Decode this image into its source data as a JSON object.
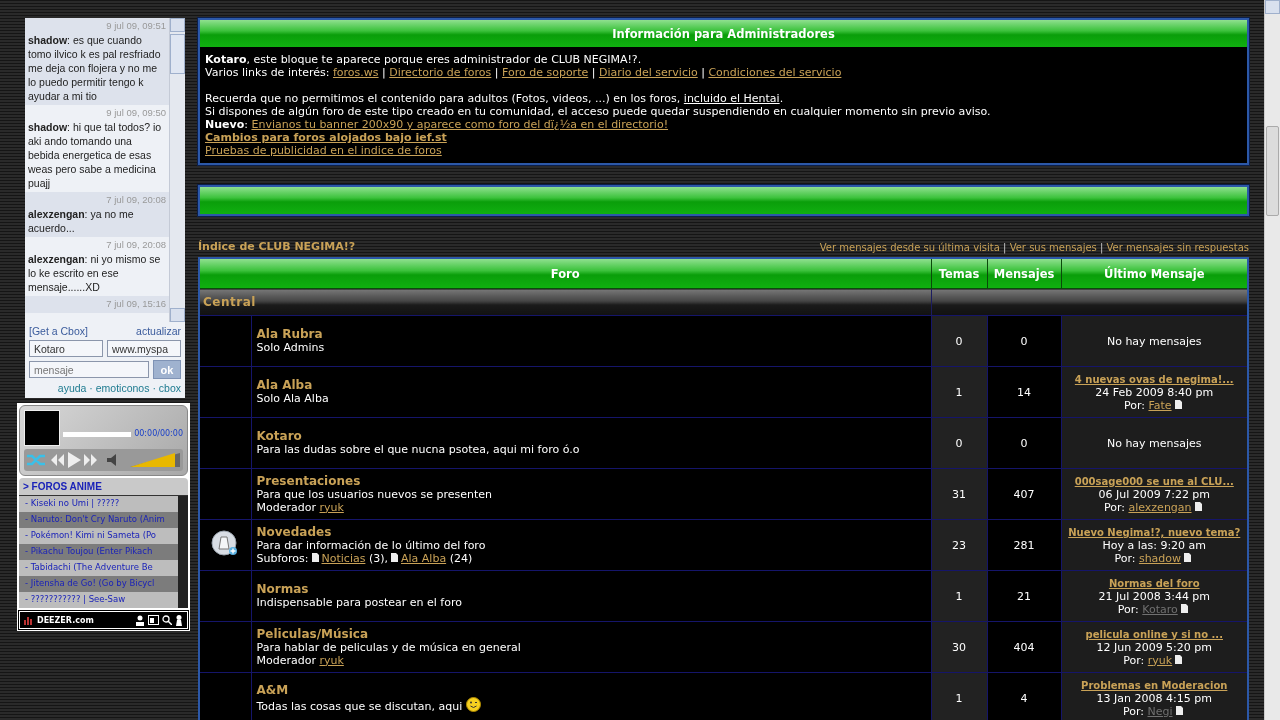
{
  "chat": {
    "messages": [
      {
        "time": "9 jul 09, 09:51",
        "author": "shadow",
        "text": ": es que cuando tomo ilvico k es pal resfriado me deja con flojera y no me lo puedo permitir tengo k ayudar a mi tio"
      },
      {
        "time": "9 jul 09, 09:50",
        "author": "shadow",
        "text": ": hi que tal todos? io aki ando tomando una bebida energetica de esas weas pero sabe a medicina puajj"
      },
      {
        "time": "7 jul 09, 20:08",
        "author": "alexzengan",
        "text": ": ya no me acuerdo..."
      },
      {
        "time": "7 jul 09, 20:08",
        "author": "alexzengan",
        "text": ": ni yo mismo se lo ke escrito en ese mensaje......XD"
      },
      {
        "time": "7 jul 09, 15:16"
      }
    ],
    "get_link": "[Get a Cbox]",
    "refresh_link": "actualizar",
    "name_value": "Kotaro",
    "url_value": "www.myspa",
    "message_placeholder": "mensaje",
    "submit": "ok",
    "footer_links": [
      "ayuda",
      "emoticonos",
      "cbox"
    ],
    "footer_separator": "·"
  },
  "player": {
    "time": "00:00/00:00",
    "progress": {
      "level": 0
    },
    "volume": {
      "level": 0.9
    },
    "playlist_title": "> FOROS ANIME",
    "tracks": [
      "- Kiseki no Umi | ?????",
      "- Naruto: Don't Cry Naruto (Anim",
      "- Pokémon! Kimi ni Sameta (Po",
      "- Pikachu Toujou (Enter Pikach",
      "- Tabidachi (The Adventure Be",
      "- Jitensha de Go! (Go by Bicycl",
      "- ??????????? | See-Saw"
    ],
    "brand": "DEEZER.com"
  },
  "admin_block": {
    "title": "Información para Administradores",
    "intro": "**Kotaro**, este bloque te aparece porque eres administrador de CLUB NEGIMA!?.",
    "links_label": "Varios links de interés:",
    "links": [
      "foros.ws",
      "Directorio de foros",
      "Foro de soporte",
      "Diario del servicio",
      "Condiciones del servicio"
    ],
    "links_separator": "|",
    "notice": {
      "text": "Recuerda que no permitimos el contenido para adultos (Fotos, videos, ...) en los foros,",
      "link": "incluido el Hentai",
      "end": "."
    },
    "warning": "Si dispones de algún foro de este tipo creado en tu comunidad, el acceso puede quedar suspendiendo en cualquier momento sin previo aviso.",
    "new_label": "**Nuevo**:",
    "new_link": "Envianos tu banner 200x90 y aparece como foro del dï¿½a en el directorio!",
    "bold_link": "Cambios para foros alojados bajo ief.st",
    "plain_link": "Pruebas de publicidad en el indice de foros"
  },
  "index": {
    "title": "Índice de CLUB NEGIMA!?",
    "links": [
      "Ver mensajes desde su última visita",
      "Ver sus mensajes",
      "Ver mensajes sin respuestas"
    ],
    "separator": "|"
  },
  "table": {
    "columns": [
      "Foro",
      "Temas",
      "Mensajes",
      "Último Mensaje"
    ],
    "category": "Central",
    "forums": [
      {
        "name": "Ala Rubra",
        "description": "Solo Admins",
        "unread": false,
        "smiley": false,
        "topics": "0",
        "posts": "0",
        "last": {
          "none_text": "No hay mensajes"
        }
      },
      {
        "name": "Ala Alba",
        "description": "Solo Ala Alba",
        "unread": false,
        "smiley": false,
        "topics": "1",
        "posts": "14",
        "last": {
          "title": "4 nuevas ovas de negima!...",
          "date": "24 Feb 2009 8:40 pm",
          "by_label": "Por:",
          "author": "Fate",
          "color": "#c9a257"
        }
      },
      {
        "name": "Kotaro",
        "description": "Para las dudas sobre el que nucna psotea, aqui mi foro ó.o",
        "unread": false,
        "smiley": false,
        "topics": "0",
        "posts": "0",
        "last": {
          "none_text": "No hay mensajes"
        }
      },
      {
        "name": "Presentaciones",
        "description": "Para que los usuarios nuevos se presenten",
        "moderator_label": "Moderador",
        "moderator": "ryuk",
        "unread": false,
        "smiley": false,
        "topics": "31",
        "posts": "407",
        "last": {
          "title": "000sage000 se une al CLU...",
          "date": "06 Jul 2009 7:22 pm",
          "by_label": "Por:",
          "author": "alexzengan",
          "color": "#c9a257"
        }
      },
      {
        "name": "Novedades",
        "description": "Para dar información de lo último del foro",
        "subforums_label": "Subforos:",
        "subforums": [
          {
            "name": "Noticias",
            "count": "(3)"
          },
          {
            "name": "Ala Alba",
            "count": "(24)"
          }
        ],
        "subforum_separator": ",",
        "unread": true,
        "smiley": false,
        "topics": "23",
        "posts": "281",
        "last": {
          "title": "Nuevo Negima!?, nuevo tema?",
          "date": "Hoy a las: 9:20 am",
          "by_label": "Por:",
          "author": "shadow",
          "color": "#c9a257"
        }
      },
      {
        "name": "Normas",
        "description": "Indispensable para postear en el foro",
        "unread": false,
        "smiley": false,
        "topics": "1",
        "posts": "21",
        "last": {
          "title": "Normas del foro",
          "date": "21 Jul 2008 3:44 pm",
          "by_label": "Por:",
          "author": "Kotaro",
          "color": "#707070"
        }
      },
      {
        "name": "Peliculas/Música",
        "description": "Para hablar de peliculas y de música en general",
        "moderator_label": "Moderador",
        "moderator": "ryuk",
        "unread": false,
        "smiley": false,
        "topics": "30",
        "posts": "404",
        "last": {
          "title": "pelicula online y si no ...",
          "date": "12 Jun 2009 5:20 pm",
          "by_label": "Por:",
          "author": "ryuk",
          "color": "#c9a257"
        }
      },
      {
        "name": "A&M",
        "description": "Todas las cosas que se discutan, aqui",
        "unread": false,
        "smiley": true,
        "topics": "1",
        "posts": "4",
        "last": {
          "title": "Problemas en Moderacion",
          "date": "13 Jan 2008 4:15 pm",
          "by_label": "Por:",
          "author": "Negi",
          "color": "#707070"
        }
      }
    ]
  }
}
